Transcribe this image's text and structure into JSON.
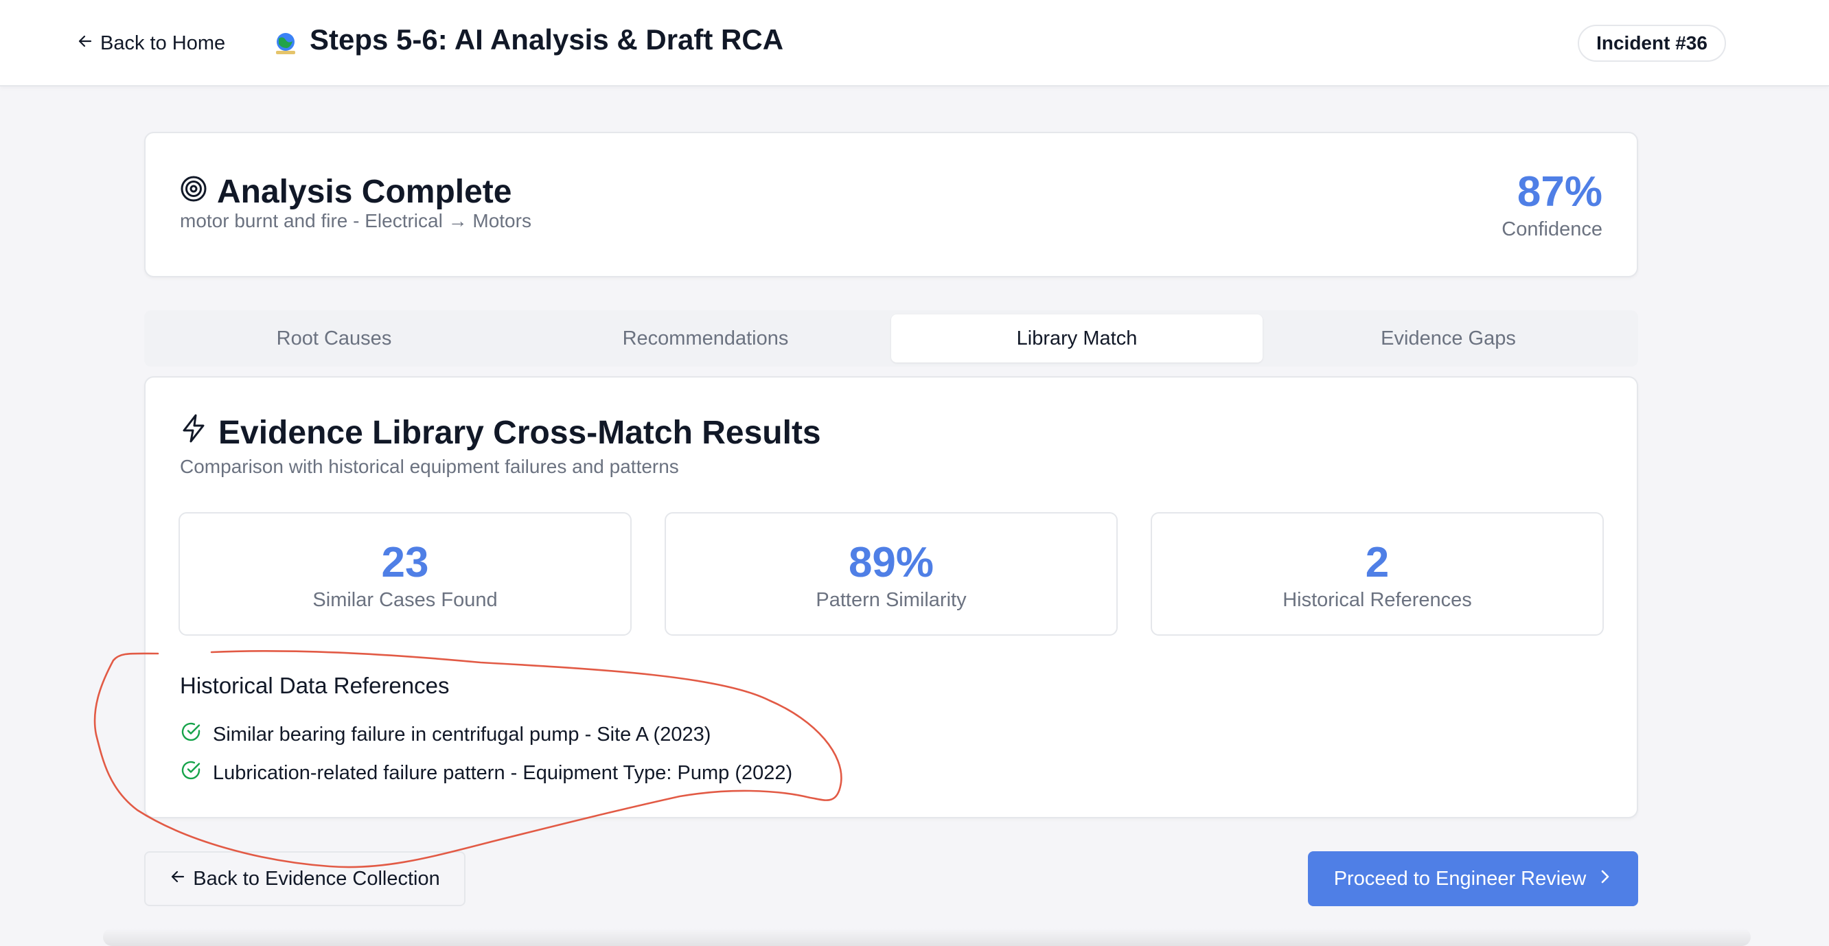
{
  "header": {
    "back_label": "Back to Home",
    "title": "Steps 5-6: AI Analysis & Draft RCA",
    "incident_badge": "Incident #36",
    "logo_icon": "globe-logo-icon"
  },
  "summary": {
    "title": "Analysis Complete",
    "subtitle": "motor burnt and fire - Electrical → Motors",
    "confidence_value": "87%",
    "confidence_label": "Confidence",
    "icon": "target-icon"
  },
  "tabs": [
    {
      "label": "Root Causes",
      "active": false
    },
    {
      "label": "Recommendations",
      "active": false
    },
    {
      "label": "Library Match",
      "active": true
    },
    {
      "label": "Evidence Gaps",
      "active": false
    }
  ],
  "library_match": {
    "title": "Evidence Library Cross-Match Results",
    "subtitle": "Comparison with historical equipment failures and patterns",
    "icon": "lightning-icon",
    "stats": [
      {
        "value": "23",
        "label": "Similar Cases Found"
      },
      {
        "value": "89%",
        "label": "Pattern Similarity"
      },
      {
        "value": "2",
        "label": "Historical References"
      }
    ],
    "references_title": "Historical Data References",
    "references": [
      "Similar bearing failure in centrifugal pump - Site A (2023)",
      "Lubrication-related failure pattern - Equipment Type: Pump (2022)"
    ]
  },
  "footer": {
    "back_label": "Back to Evidence Collection",
    "proceed_label": "Proceed to Engineer Review"
  },
  "colors": {
    "accent": "#4f7fe6",
    "success": "#16a34a",
    "annotation": "#e25a45"
  }
}
